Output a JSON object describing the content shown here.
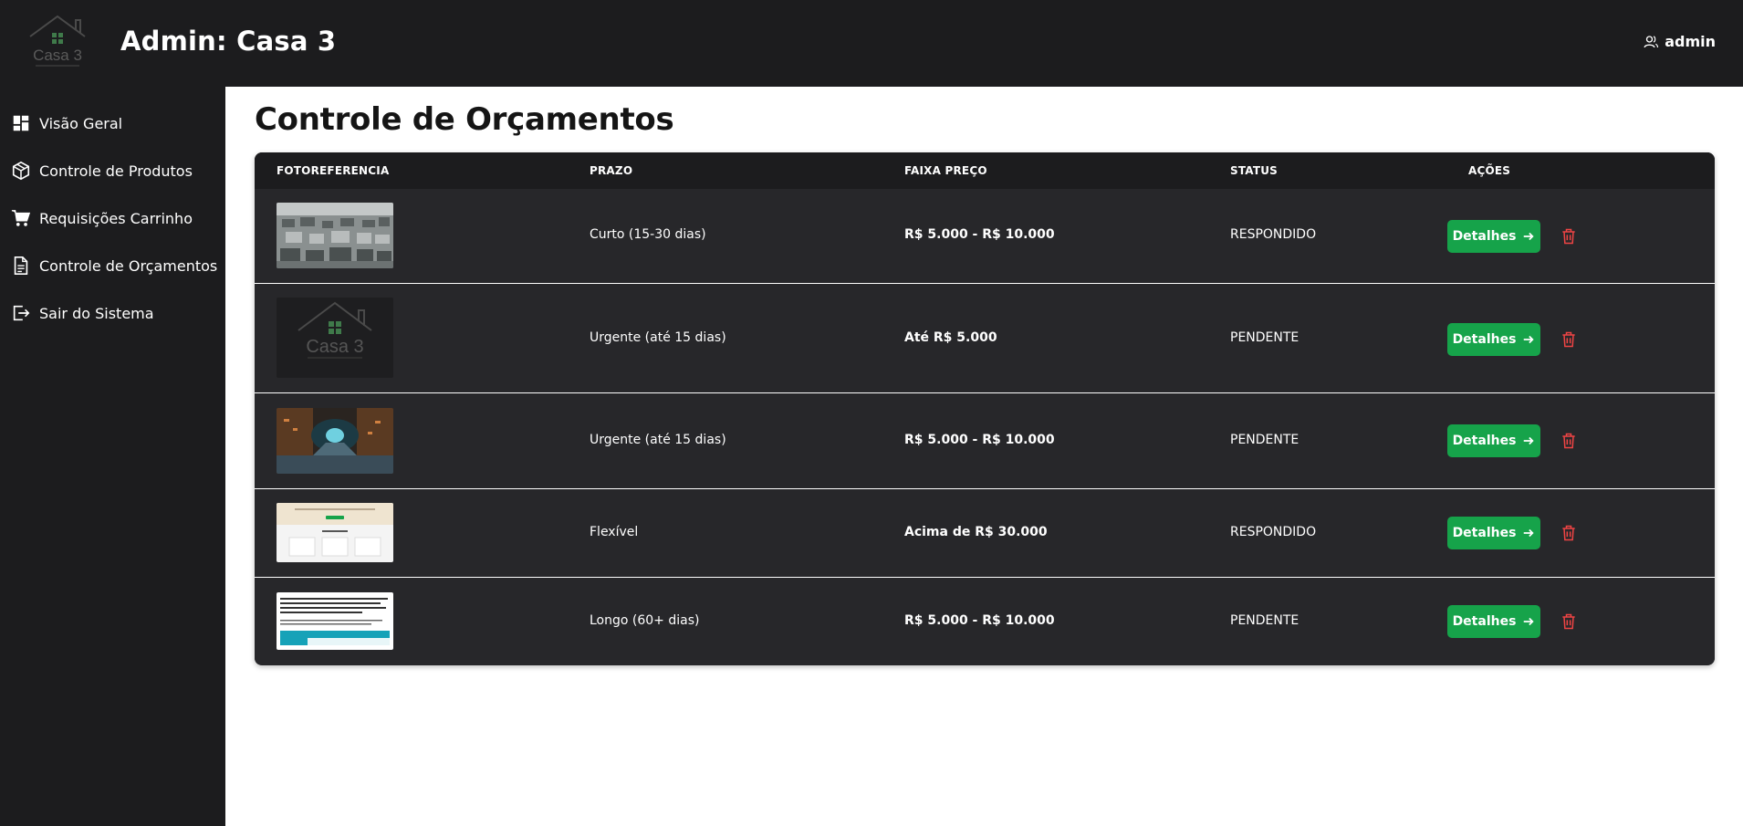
{
  "app": {
    "title": "Admin: Casa 3",
    "logo_text": "Casa 3",
    "user_name": "admin"
  },
  "sidebar": {
    "items": [
      {
        "label": "Visão Geral",
        "icon": "dashboard-icon"
      },
      {
        "label": "Controle de Produtos",
        "icon": "box-icon"
      },
      {
        "label": "Requisições Carrinho",
        "icon": "cart-icon"
      },
      {
        "label": "Controle de Orçamentos",
        "icon": "document-icon"
      },
      {
        "label": "Sair do Sistema",
        "icon": "logout-icon"
      }
    ]
  },
  "main": {
    "title": "Controle de Orçamentos"
  },
  "table": {
    "headers": {
      "foto": "FOTOREFERENCIA",
      "prazo": "PRAZO",
      "faixa": "FAIXA PREÇO",
      "status": "STATUS",
      "acoes": "AÇÕES"
    },
    "rows": [
      {
        "thumbnail": "village-aerial-photo",
        "prazo": "Curto (15-30 dias)",
        "faixa": "R$ 5.000 - R$ 10.000",
        "status": "RESPONDIDO",
        "action_label": "Detalhes"
      },
      {
        "thumbnail": "casa3-logo-image",
        "prazo": "Urgente (até 15 dias)",
        "faixa": "Até R$ 5.000",
        "status": "PENDENTE",
        "action_label": "Detalhes"
      },
      {
        "thumbnail": "scifi-tunnel-image",
        "prazo": "Urgente (até 15 dias)",
        "faixa": "R$ 5.000 - R$ 10.000",
        "status": "PENDENTE",
        "action_label": "Detalhes"
      },
      {
        "thumbnail": "website-screenshot",
        "prazo": "Flexível",
        "faixa": "Acima de R$ 30.000",
        "status": "RESPONDIDO",
        "action_label": "Detalhes"
      },
      {
        "thumbnail": "document-screenshot",
        "prazo": "Longo (60+ dias)",
        "faixa": "R$ 5.000 - R$ 10.000",
        "status": "PENDENTE",
        "action_label": "Detalhes"
      }
    ]
  },
  "colors": {
    "header_bg": "#1c1c1e",
    "table_row_bg": "#27272a",
    "accent_green": "#16a34a",
    "delete_red": "#ef4444"
  }
}
